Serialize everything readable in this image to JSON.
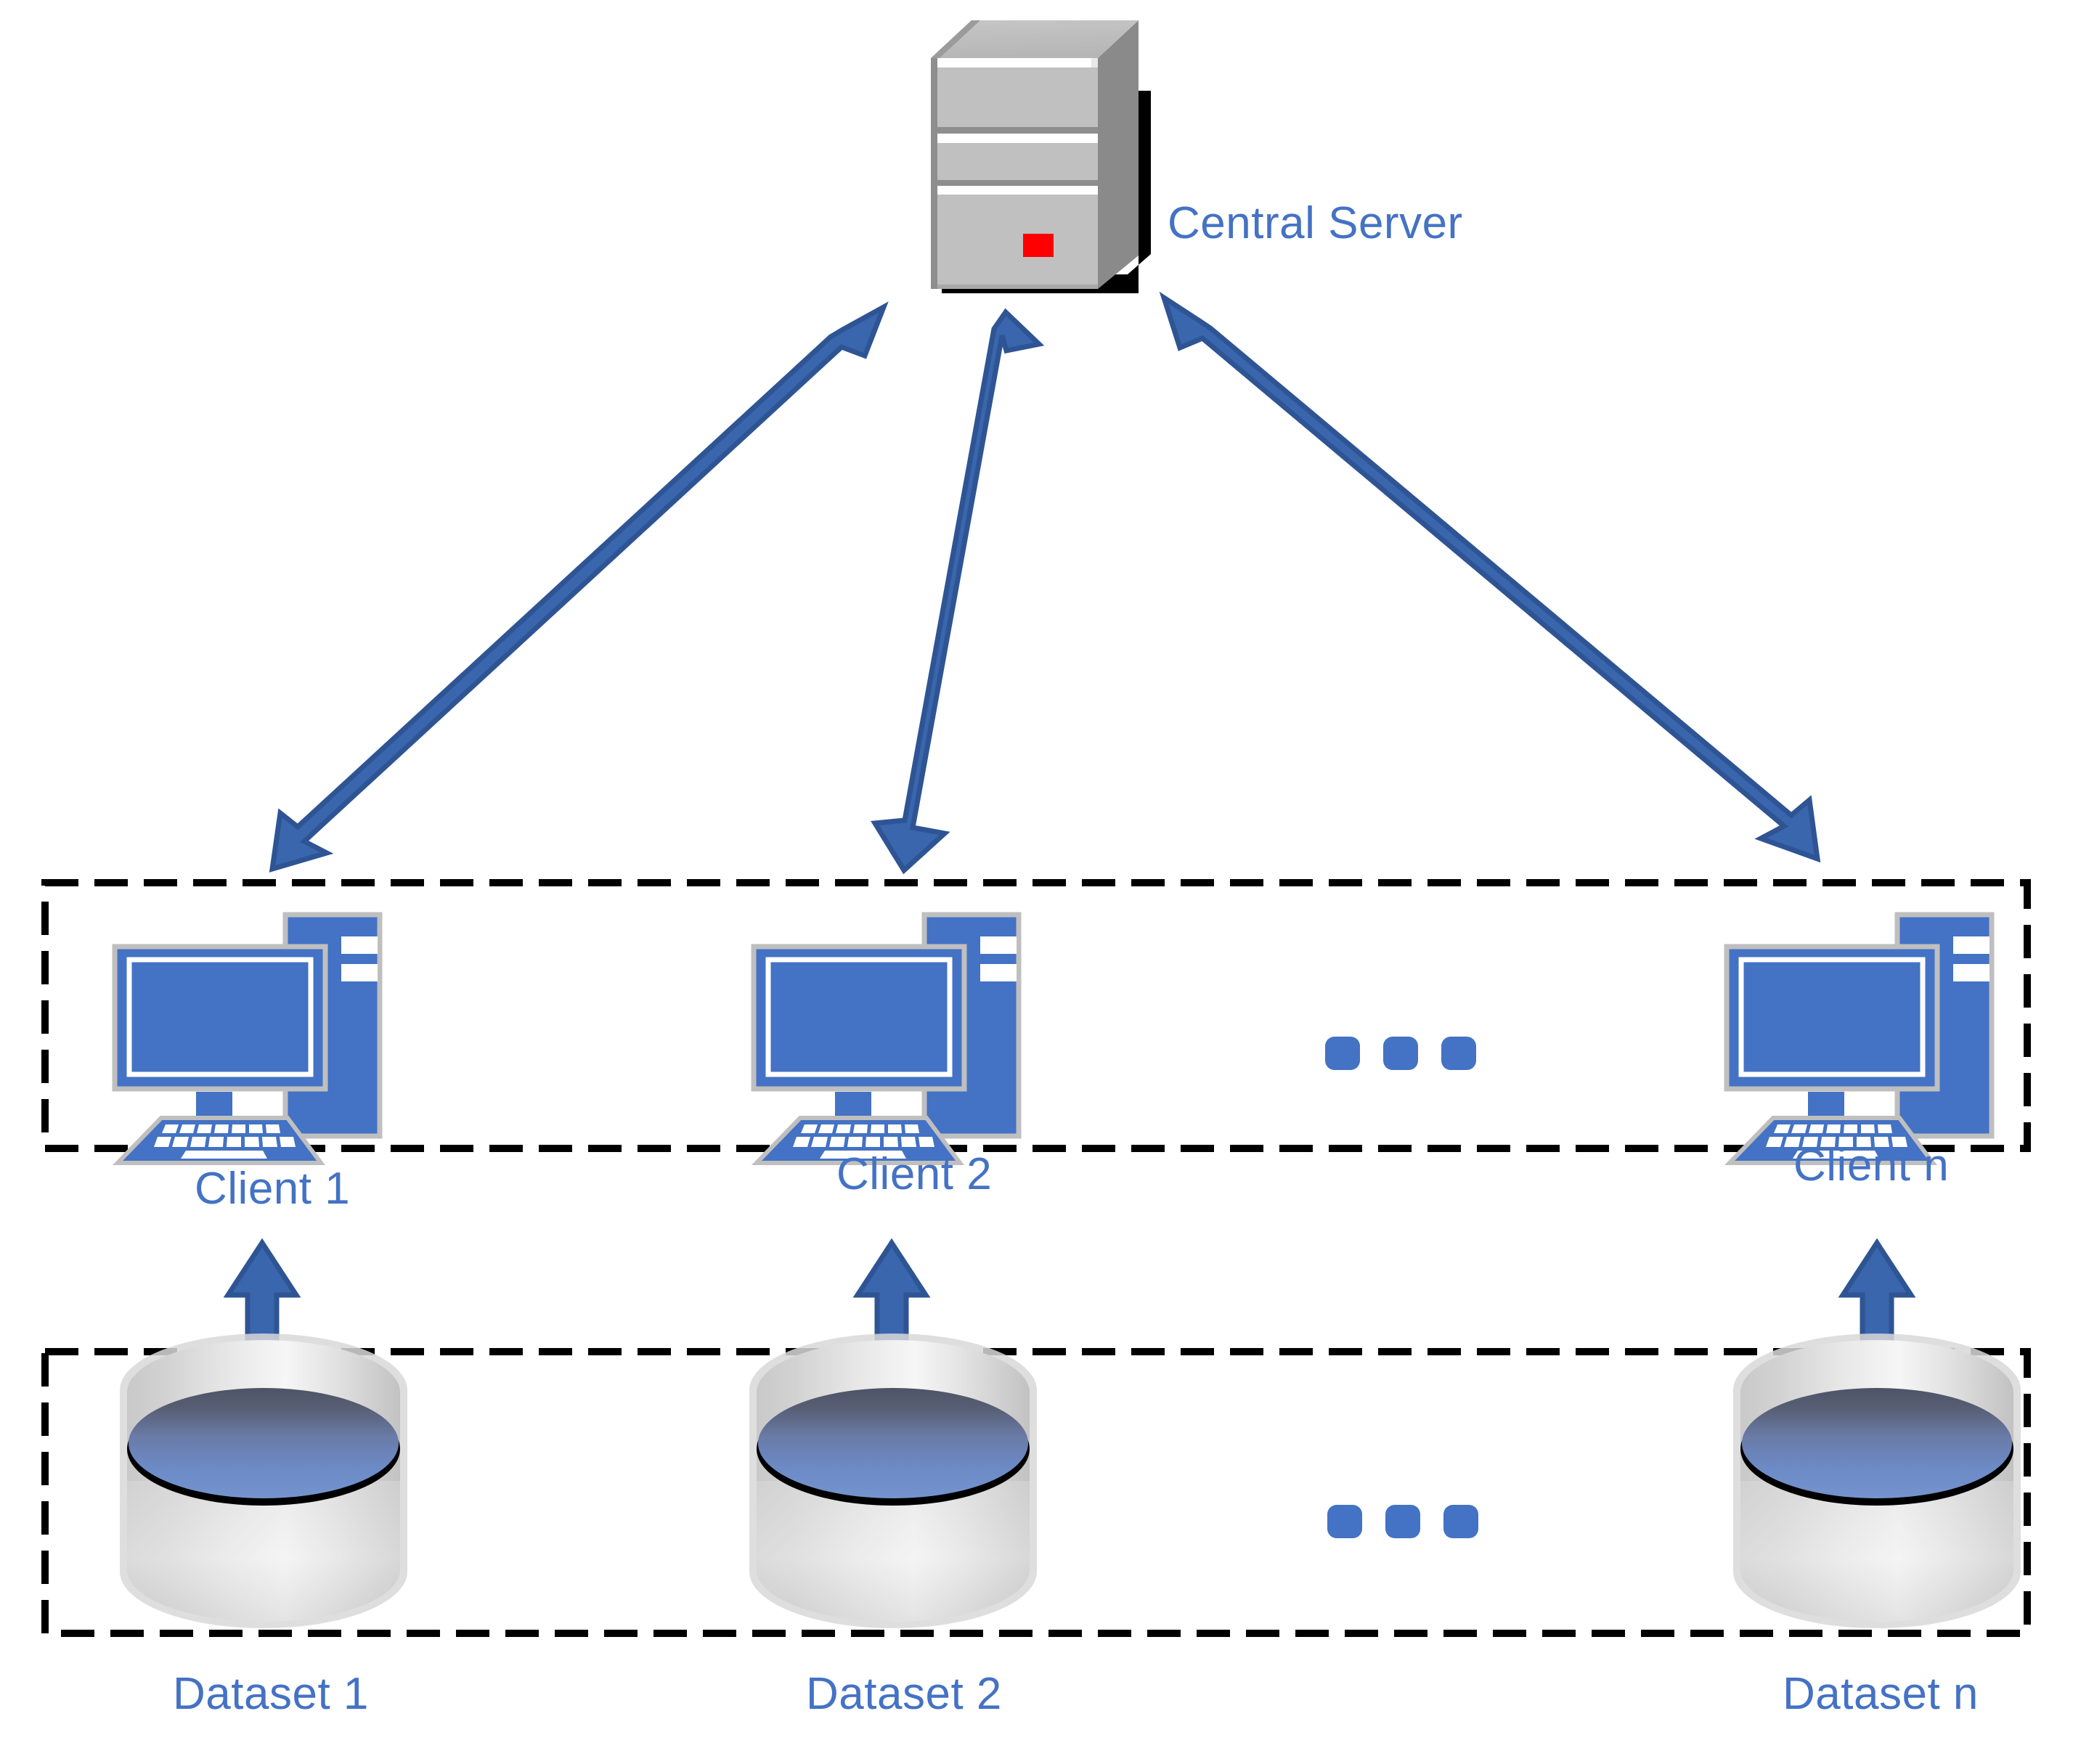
{
  "diagram": {
    "title_text": "Central Server",
    "colors": {
      "accent_blue": "#4472C4",
      "arrow_fill": "#3A66AD",
      "arrow_stroke": "#2E5494",
      "server_front": "#C0C0C0",
      "server_side": "#808080",
      "server_top": "#BEBEBE",
      "server_led": "#FF0000",
      "dashed_border": "#000000",
      "cylinder_top_dark": "#5A6077",
      "cylinder_top_light": "#6E8CC8",
      "cylinder_body_light": "#F2F2F2",
      "cylinder_body_gray": "#C9C9C9",
      "icon_outline": "#BFBFBF"
    },
    "server": {
      "name": "central-server",
      "label": "Central Server",
      "led_label": "power-led"
    },
    "clients_group": {
      "border_style": "dashed",
      "items": [
        {
          "label": "Client 1",
          "icon": "desktop-computer-icon"
        },
        {
          "label": "Client 2",
          "icon": "desktop-computer-icon"
        },
        {
          "label": "Client n",
          "icon": "desktop-computer-icon"
        }
      ],
      "ellipsis": "•  •  •"
    },
    "datasets_group": {
      "border_style": "dashed",
      "items": [
        {
          "label": "Dataset 1",
          "icon": "database-cylinder-icon"
        },
        {
          "label": "Dataset 2",
          "icon": "database-cylinder-icon"
        },
        {
          "label": "Dataset n",
          "icon": "database-cylinder-icon"
        }
      ],
      "ellipsis": "•  •  •"
    },
    "connections": {
      "server_to_clients": [
        {
          "from": "central-server",
          "to": "Client 1",
          "style": "double-headed-arrow"
        },
        {
          "from": "central-server",
          "to": "Client 2",
          "style": "double-headed-arrow"
        },
        {
          "from": "central-server",
          "to": "Client n",
          "style": "double-headed-arrow"
        }
      ],
      "datasets_to_clients": [
        {
          "from": "Dataset 1",
          "to": "Client 1",
          "style": "single-headed-arrow-up"
        },
        {
          "from": "Dataset 2",
          "to": "Client 2",
          "style": "single-headed-arrow-up"
        },
        {
          "from": "Dataset n",
          "to": "Client n",
          "style": "single-headed-arrow-up"
        }
      ]
    }
  }
}
